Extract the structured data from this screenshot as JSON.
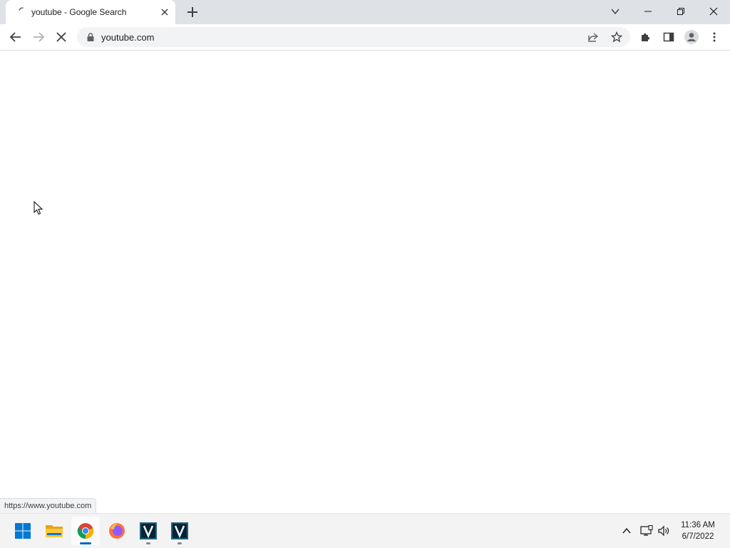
{
  "browser": {
    "tab": {
      "title": "youtube - Google Search"
    },
    "address_bar": {
      "url": "youtube.com"
    },
    "status_bar": {
      "url": "https://www.youtube.com"
    }
  },
  "toolbar_icons": [
    "back-icon",
    "forward-icon",
    "stop-loading-icon",
    "lock-icon",
    "share-icon",
    "bookmark-star-icon",
    "extensions-icon",
    "side-panel-icon",
    "profile-icon",
    "menu-icon"
  ],
  "taskbar": {
    "apps": [
      "windows-start",
      "file-explorer",
      "google-chrome",
      "firefox",
      "app-v",
      "app-v"
    ],
    "clock": {
      "time": "11:36 AM",
      "date": "6/7/2022"
    }
  },
  "colors": {
    "tabstrip": "#dee1e6",
    "omnibox": "#f1f3f4",
    "accent": "#0067c0"
  }
}
